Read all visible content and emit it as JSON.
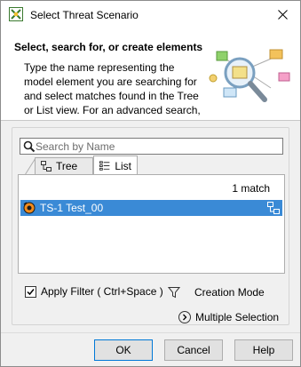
{
  "window": {
    "title": "Select Threat Scenario"
  },
  "header": {
    "title": "Select, search for, or create elements",
    "description": "Type the name representing the model element you are searching for and select matches found in the Tree or List view. For an advanced search,"
  },
  "search": {
    "placeholder": "Search by Name",
    "value": ""
  },
  "tabs": [
    {
      "label": "Tree",
      "selected": false
    },
    {
      "label": "List",
      "selected": true
    }
  ],
  "results": {
    "match_count": "1 match",
    "items": [
      {
        "label": "TS-1 Test_00",
        "selected": true
      }
    ]
  },
  "options": {
    "apply_filter_label": "Apply Filter ( Ctrl+Space )",
    "apply_filter_checked": true,
    "creation_mode_label": "Creation Mode",
    "multiple_selection_label": "Multiple Selection"
  },
  "buttons": {
    "ok": "OK",
    "cancel": "Cancel",
    "help": "Help"
  },
  "colors": {
    "selection": "#3a8ad6",
    "default_button_border": "#0078d7"
  }
}
